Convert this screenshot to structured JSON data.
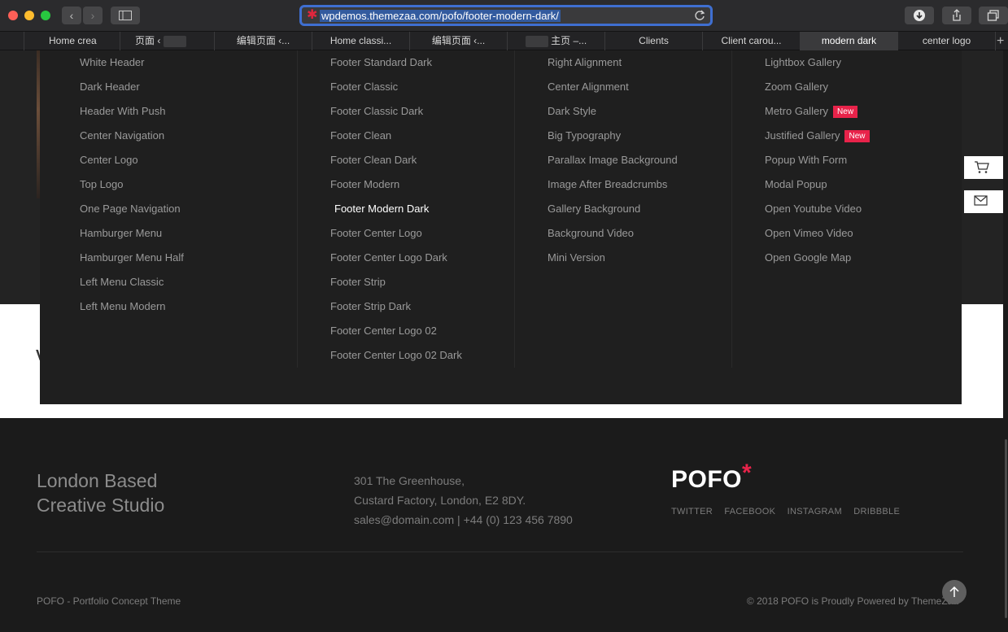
{
  "browser": {
    "url": "wpdemos.themezaa.com/pofo/footer-modern-dark/",
    "tabs": [
      {
        "label": "Home crea"
      },
      {
        "label": "页面 ‹"
      },
      {
        "label": "编辑页面 ‹..."
      },
      {
        "label": "Home classi..."
      },
      {
        "label": "编辑页面 ‹..."
      },
      {
        "label": "主页 –..."
      },
      {
        "label": "Clients"
      },
      {
        "label": "Client carou..."
      },
      {
        "label": "modern dark"
      },
      {
        "label": "center logo"
      }
    ],
    "new_tab_symbol": "+"
  },
  "megamenu": {
    "col1": [
      "White Header",
      "Dark Header",
      "Header With Push",
      "Center Navigation",
      "Center Logo",
      "Top Logo",
      "One Page Navigation",
      "Hamburger Menu",
      "Hamburger Menu Half",
      "Left Menu Classic",
      "Left Menu Modern"
    ],
    "col2": [
      "Footer Standard Dark",
      "Footer Classic",
      "Footer Classic Dark",
      "Footer Clean",
      "Footer Clean Dark",
      "Footer Modern",
      "Footer Modern Dark",
      "Footer Center Logo",
      "Footer Center Logo Dark",
      "Footer Strip",
      "Footer Strip Dark",
      "Footer Center Logo 02",
      "Footer Center Logo 02 Dark"
    ],
    "col3": [
      "Right Alignment",
      "Center Alignment",
      "Dark Style",
      "Big Typography",
      "Parallax Image Background",
      "Image After Breadcrumbs",
      "Gallery Background",
      "Background Video",
      "Mini Version"
    ],
    "col4": [
      "Lightbox Gallery",
      "Zoom Gallery",
      "Metro Gallery",
      "Justified Gallery",
      "Popup With Form",
      "Modal Popup",
      "Open Youtube Video",
      "Open Vimeo Video",
      "Open Google Map"
    ],
    "badge_label": "New",
    "white_section_fragment": "V"
  },
  "footer": {
    "tagline_line1": "London Based",
    "tagline_line2": "Creative Studio",
    "address_line1": "301 The Greenhouse,",
    "address_line2": "Custard Factory, London, E2 8DY.",
    "contact": "sales@domain.com | +44 (0) 123 456 7890",
    "logo_text": "POFO",
    "logo_mark": "*",
    "social": [
      "TWITTER",
      "FACEBOOK",
      "INSTAGRAM",
      "DRIBBBLE"
    ],
    "copyright_left": "POFO - Portfolio Concept Theme",
    "copyright_right": "© 2018 POFO is Proudly Powered by  ThemeZaa"
  },
  "colors": {
    "accent": "#e8234a",
    "page_bg": "#1b1b1b",
    "menu_bg": "#1f1f1f",
    "url_focus": "#3f6fd1"
  },
  "icons": [
    "back-icon",
    "forward-icon",
    "sidebar-icon",
    "reload-icon",
    "download-icon",
    "share-icon",
    "tabs-icon",
    "cart-icon",
    "mail-icon",
    "arrow-up-icon"
  ]
}
